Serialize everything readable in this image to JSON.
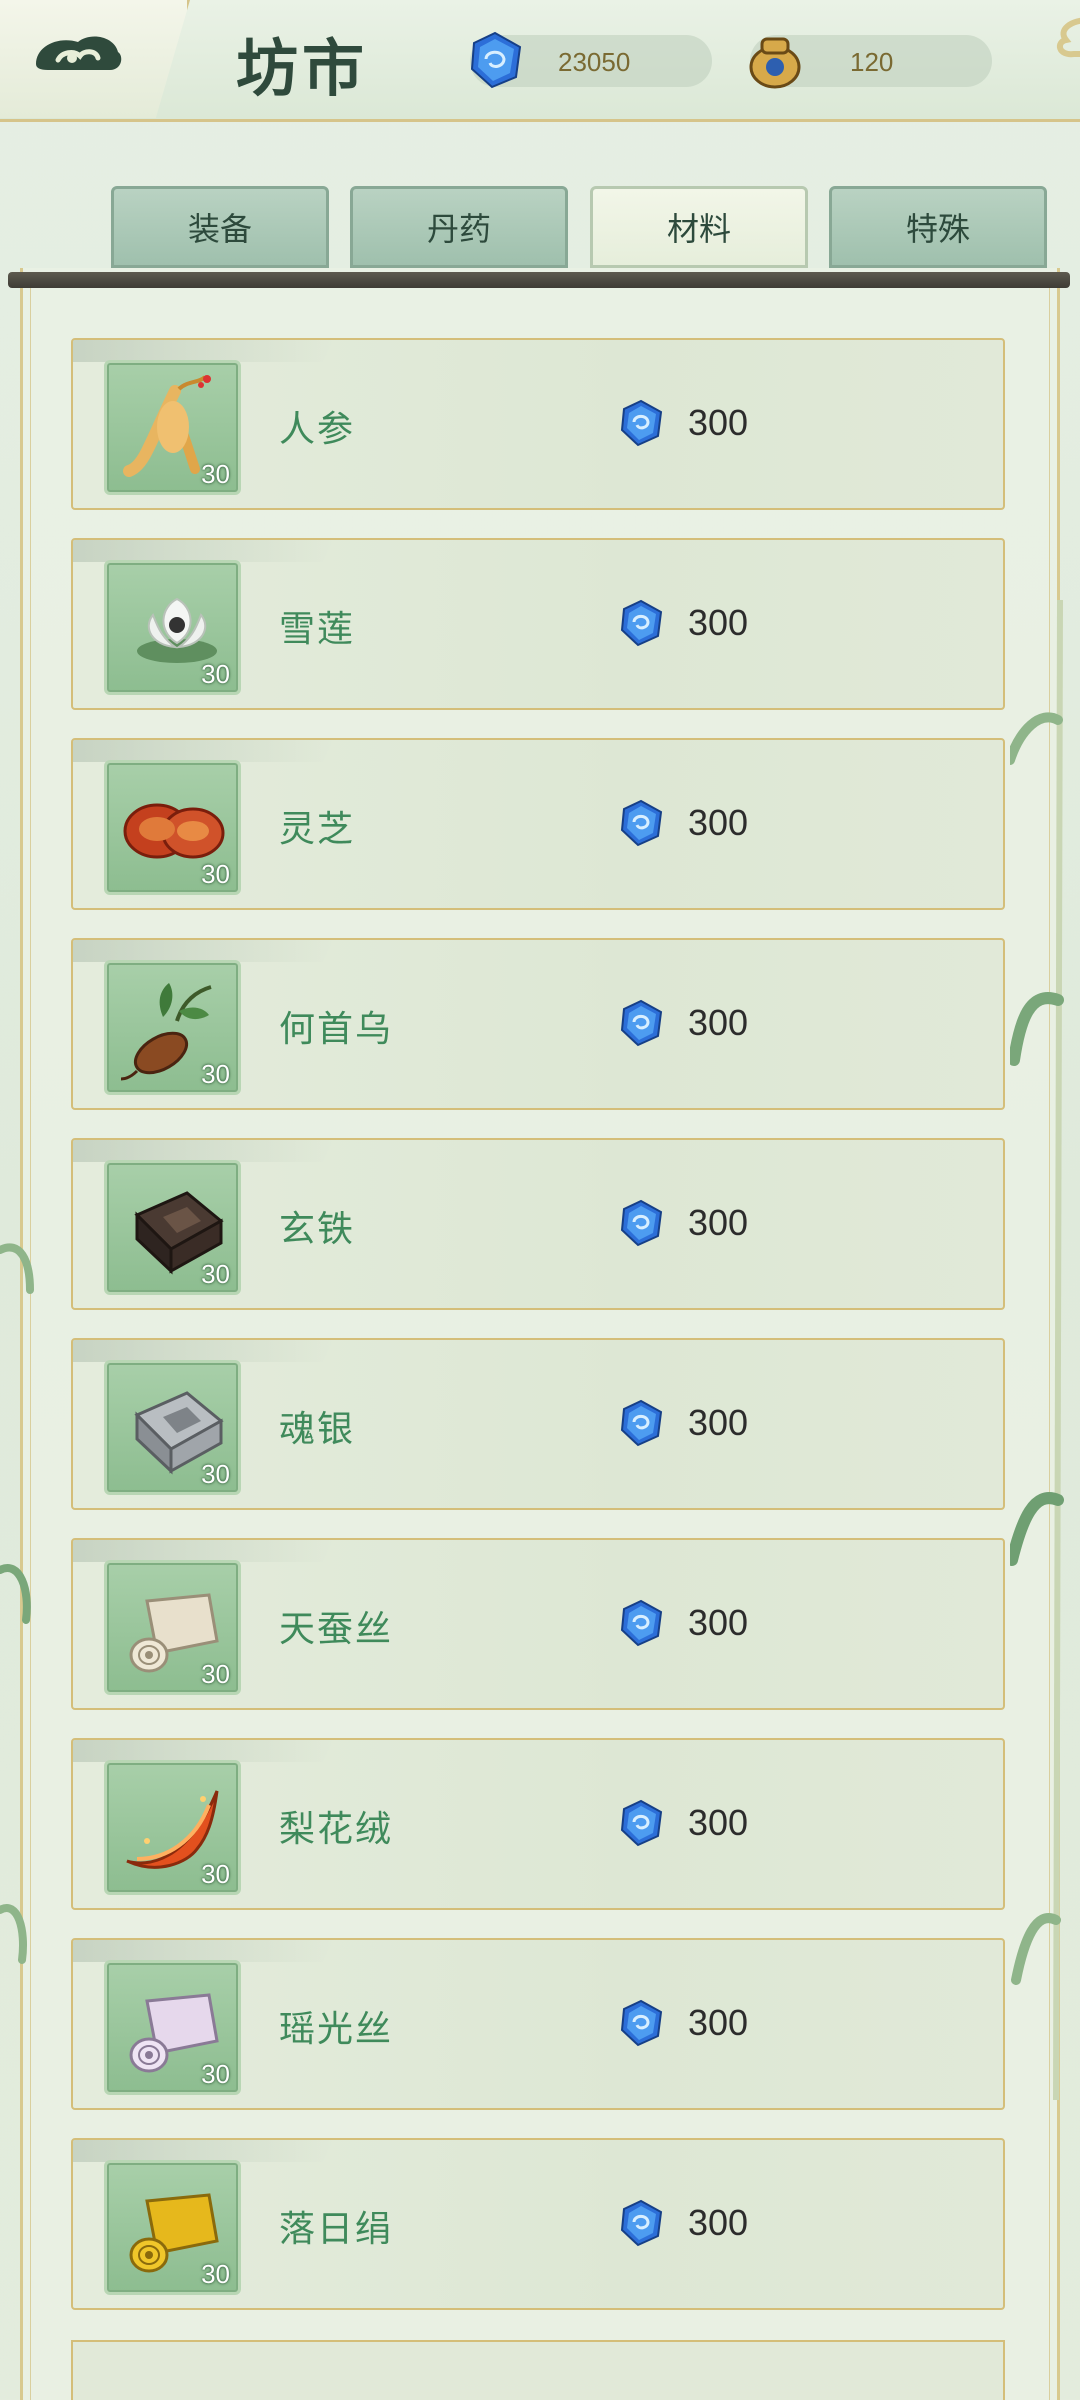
{
  "header": {
    "title": "坊市",
    "spirit_stones": "23050",
    "tokens": "120"
  },
  "tabs": [
    {
      "label": "装备",
      "active": false
    },
    {
      "label": "丹药",
      "active": false
    },
    {
      "label": "材料",
      "active": true
    },
    {
      "label": "特殊",
      "active": false
    }
  ],
  "items": [
    {
      "name": "人参",
      "qty": "30",
      "price": "300",
      "icon": "ginseng-icon"
    },
    {
      "name": "雪莲",
      "qty": "30",
      "price": "300",
      "icon": "snow-lotus-icon"
    },
    {
      "name": "灵芝",
      "qty": "30",
      "price": "300",
      "icon": "lingzhi-icon"
    },
    {
      "name": "何首乌",
      "qty": "30",
      "price": "300",
      "icon": "heshouwu-icon"
    },
    {
      "name": "玄铁",
      "qty": "30",
      "price": "300",
      "icon": "dark-iron-icon"
    },
    {
      "name": "魂银",
      "qty": "30",
      "price": "300",
      "icon": "soul-silver-icon"
    },
    {
      "name": "天蚕丝",
      "qty": "30",
      "price": "300",
      "icon": "silk-roll-icon"
    },
    {
      "name": "梨花绒",
      "qty": "30",
      "price": "300",
      "icon": "pear-blossom-fluff-icon"
    },
    {
      "name": "瑶光丝",
      "qty": "30",
      "price": "300",
      "icon": "yaoguang-silk-icon"
    },
    {
      "name": "落日绢",
      "qty": "30",
      "price": "300",
      "icon": "sunset-silk-icon"
    }
  ],
  "colors": {
    "item_name": "#3f8a5b",
    "frame_gold": "#d4be79",
    "gem_blue": "#2f6fd6"
  }
}
